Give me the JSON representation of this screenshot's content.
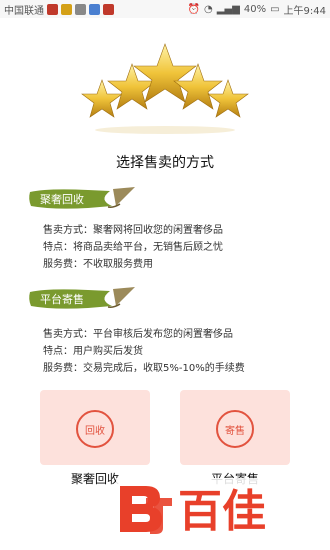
{
  "status_bar": {
    "carrier": "中国联通",
    "battery": "40%",
    "time": "上午9:44"
  },
  "page_title": "选择售卖的方式",
  "sections": [
    {
      "banner": "聚奢回收",
      "lines": [
        "售卖方式：聚奢网将回收您的闲置奢侈品",
        "特点：将商品卖给平台，无销售后顾之忧",
        "服务费：不收取服务费用"
      ]
    },
    {
      "banner": "平台寄售",
      "lines": [
        "售卖方式：平台审核后发布您的闲置奢侈品",
        "特点：用户购买后发货",
        "服务费：交易完成后，收取5%-10%的手续费"
      ]
    }
  ],
  "options": [
    {
      "circle": "回收",
      "label": "聚奢回收"
    },
    {
      "circle": "寄售",
      "label": "平台寄售"
    }
  ],
  "watermark": "百佳",
  "colors": {
    "banner_green": "#7a9a2e",
    "accent_red": "#e2533f",
    "card_bg": "#fde1dc",
    "star_gold": "#e9b92b"
  }
}
